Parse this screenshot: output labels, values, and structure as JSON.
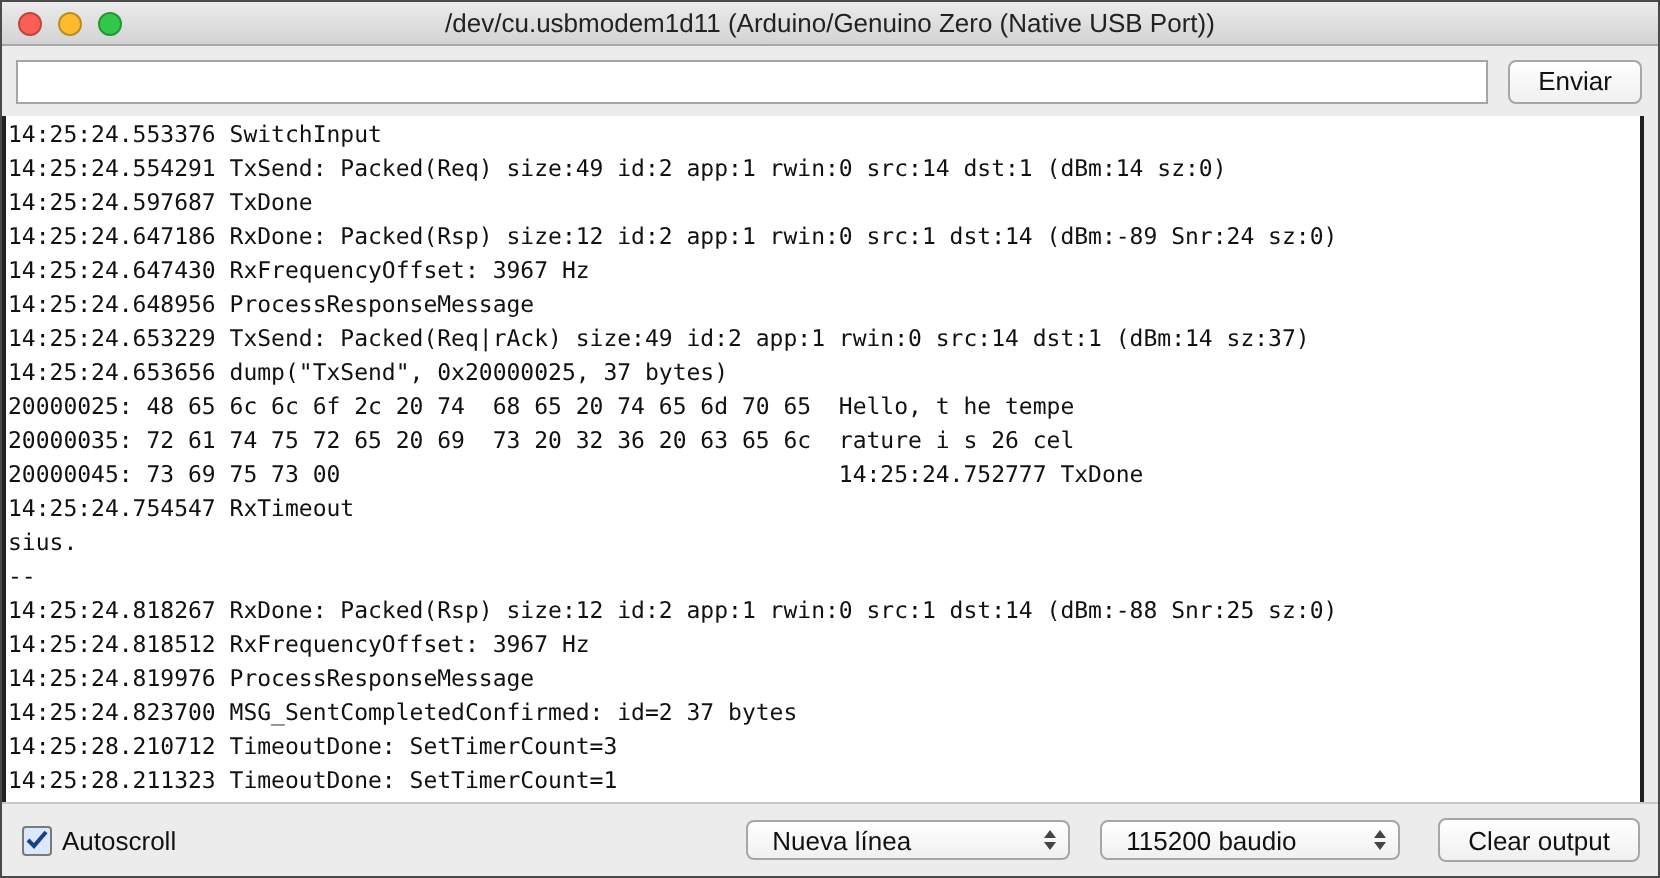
{
  "window": {
    "title": "/dev/cu.usbmodem1d11 (Arduino/Genuino Zero (Native USB Port))"
  },
  "send": {
    "button": "Enviar"
  },
  "output": {
    "lines": [
      "14:25:24.553376 SwitchInput",
      "14:25:24.554291 TxSend: Packed(Req) size:49 id:2 app:1 rwin:0 src:14 dst:1 (dBm:14 sz:0)",
      "14:25:24.597687 TxDone",
      "14:25:24.647186 RxDone: Packed(Rsp) size:12 id:2 app:1 rwin:0 src:1 dst:14 (dBm:-89 Snr:24 sz:0)",
      "14:25:24.647430 RxFrequencyOffset: 3967 Hz",
      "14:25:24.648956 ProcessResponseMessage",
      "14:25:24.653229 TxSend: Packed(Req|rAck) size:49 id:2 app:1 rwin:0 src:14 dst:1 (dBm:14 sz:37)",
      "14:25:24.653656 dump(\"TxSend\", 0x20000025, 37 bytes)",
      "20000025: 48 65 6c 6c 6f 2c 20 74  68 65 20 74 65 6d 70 65  Hello, t he tempe",
      "20000035: 72 61 74 75 72 65 20 69  73 20 32 36 20 63 65 6c  rature i s 26 cel",
      "20000045: 73 69 75 73 00                                    14:25:24.752777 TxDone",
      "14:25:24.754547 RxTimeout",
      "sius.",
      "--",
      "14:25:24.818267 RxDone: Packed(Rsp) size:12 id:2 app:1 rwin:0 src:1 dst:14 (dBm:-88 Snr:25 sz:0)",
      "14:25:24.818512 RxFrequencyOffset: 3967 Hz",
      "14:25:24.819976 ProcessResponseMessage",
      "14:25:24.823700 MSG_SentCompletedConfirmed: id=2 37 bytes",
      "14:25:28.210712 TimeoutDone: SetTimerCount=3",
      "14:25:28.211323 TimeoutDone: SetTimerCount=1"
    ]
  },
  "footer": {
    "autoscroll": {
      "label": "Autoscroll",
      "checked": true
    },
    "line_ending": "Nueva línea",
    "baud_rate": "115200 baudio",
    "clear_button": "Clear output"
  }
}
